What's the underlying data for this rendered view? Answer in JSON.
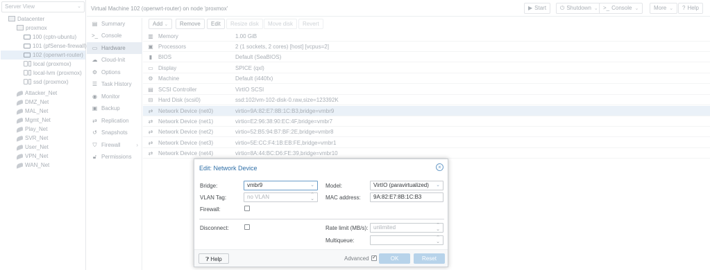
{
  "tree": {
    "view_label": "Server View",
    "datacenter": "Datacenter",
    "node": "proxmox",
    "vms": [
      "100 (cptn-ubuntu)",
      "101 (pfSense-firewall)",
      "102 (openwrt-router)"
    ],
    "storages": [
      "local (proxmox)",
      "local-lvm (proxmox)",
      "ssd (proxmox)"
    ],
    "networks": [
      "Attacker_Net",
      "DMZ_Net",
      "MAL_Net",
      "Mgmt_Net",
      "Play_Net",
      "SVR_Net",
      "User_Net",
      "VPN_Net",
      "WAN_Net"
    ]
  },
  "header": {
    "title": "Virtual Machine 102 (openwrt-router) on node 'proxmox'",
    "start": "Start",
    "shutdown": "Shutdown",
    "console": "Console",
    "more": "More",
    "help": "Help"
  },
  "menu": [
    "Summary",
    "Console",
    "Hardware",
    "Cloud-Init",
    "Options",
    "Task History",
    "Monitor",
    "Backup",
    "Replication",
    "Snapshots",
    "Firewall",
    "Permissions"
  ],
  "toolbar": {
    "add": "Add",
    "remove": "Remove",
    "edit": "Edit",
    "resize": "Resize disk",
    "move": "Move disk",
    "revert": "Revert"
  },
  "hardware": [
    {
      "key": "Memory",
      "value": "1.00 GiB",
      "icon": "memory-icon"
    },
    {
      "key": "Processors",
      "value": "2 (1 sockets, 2 cores) [host] [vcpus=2]",
      "icon": "cpu-icon"
    },
    {
      "key": "BIOS",
      "value": "Default (SeaBIOS)",
      "icon": "bios-icon"
    },
    {
      "key": "Display",
      "value": "SPICE (qxl)",
      "icon": "display-icon"
    },
    {
      "key": "Machine",
      "value": "Default (i440fx)",
      "icon": "machine-icon"
    },
    {
      "key": "SCSI Controller",
      "value": "VirtIO SCSI",
      "icon": "scsi-icon"
    },
    {
      "key": "Hard Disk (scsi0)",
      "value": "ssd:102/vm-102-disk-0.raw,size=123392K",
      "icon": "hdd-icon"
    },
    {
      "key": "Network Device (net0)",
      "value": "virtio=9A:82:E7:8B:1C:B3,bridge=vmbr9",
      "icon": "network-icon"
    },
    {
      "key": "Network Device (net1)",
      "value": "virtio=E2:96:38:90:EC:4F,bridge=vmbr7",
      "icon": "network-icon"
    },
    {
      "key": "Network Device (net2)",
      "value": "virtio=52:B5:94:B7:BF:2E,bridge=vmbr8",
      "icon": "network-icon"
    },
    {
      "key": "Network Device (net3)",
      "value": "virtio=5E:CC:F4:1B:EB:FE,bridge=vmbr1",
      "icon": "network-icon"
    },
    {
      "key": "Network Device (net4)",
      "value": "virtio=8A:44:BC:D6:FE:39,bridge=vmbr10",
      "icon": "network-icon"
    }
  ],
  "dialog": {
    "title": "Edit: Network Device",
    "bridge_label": "Bridge:",
    "bridge_value": "vmbr9",
    "vlan_label": "VLAN Tag:",
    "vlan_placeholder": "no VLAN",
    "firewall_label": "Firewall:",
    "model_label": "Model:",
    "model_value": "VirtIO (paravirtualized)",
    "mac_label": "MAC address:",
    "mac_value": "9A:82:E7:8B:1C:B3",
    "disconnect_label": "Disconnect:",
    "rate_label": "Rate limit (MB/s):",
    "rate_placeholder": "unlimited",
    "multiqueue_label": "Multiqueue:",
    "help": "Help",
    "advanced": "Advanced",
    "ok": "OK",
    "reset": "Reset"
  }
}
